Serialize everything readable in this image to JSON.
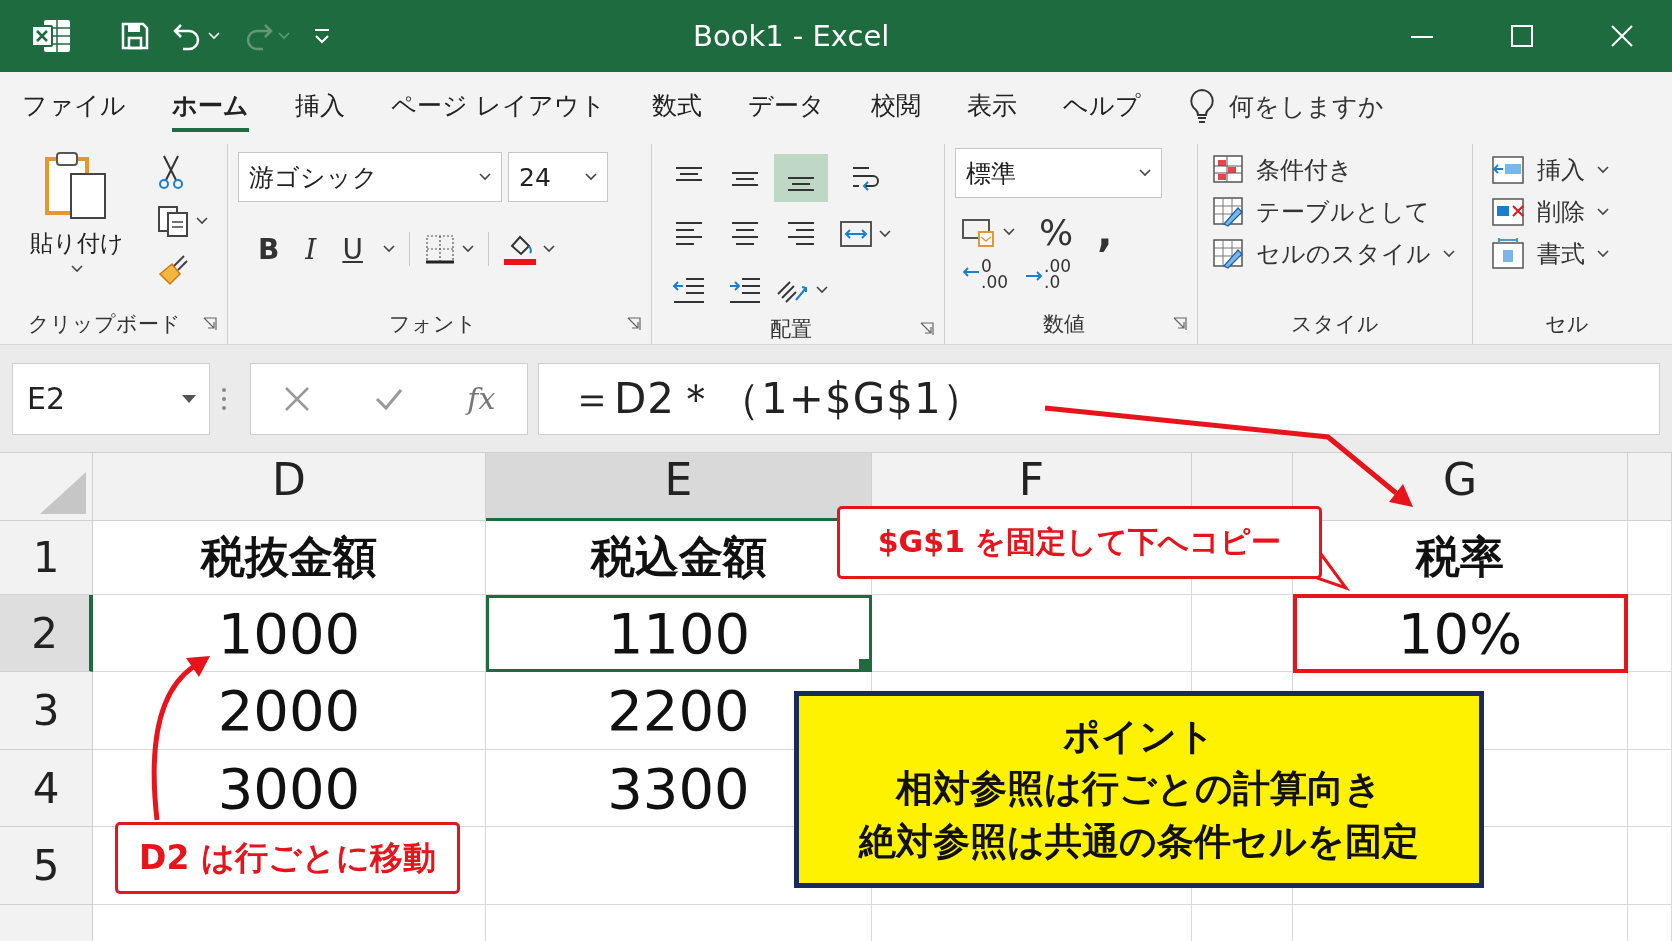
{
  "window": {
    "title": "Book1 - Excel"
  },
  "quick_access": [
    {
      "kind": "save"
    },
    {
      "kind": "undo",
      "disabled": false
    },
    {
      "kind": "redo",
      "disabled": true
    },
    {
      "kind": "customize"
    }
  ],
  "tabs": [
    {
      "label": "ファイル",
      "selected": false
    },
    {
      "label": "ホーム",
      "selected": true
    },
    {
      "label": "挿入",
      "selected": false
    },
    {
      "label": "ページ レイアウト",
      "selected": false
    },
    {
      "label": "数式",
      "selected": false
    },
    {
      "label": "データ",
      "selected": false
    },
    {
      "label": "校閲",
      "selected": false
    },
    {
      "label": "表示",
      "selected": false
    },
    {
      "label": "ヘルプ",
      "selected": false
    }
  ],
  "tell_me": {
    "placeholder": "何をしますか"
  },
  "ribbon": [
    {
      "kind": "clipboard",
      "label": "クリップボード",
      "paste": "貼り付け"
    },
    {
      "kind": "font",
      "label": "フォント",
      "font_name": "游ゴシック",
      "font_size": "24",
      "styles": [
        {
          "kind": "bold",
          "text": "B"
        },
        {
          "kind": "italic",
          "text": "I"
        },
        {
          "kind": "underline",
          "text": "U"
        }
      ]
    },
    {
      "kind": "alignment",
      "label": "配置",
      "vertical": [
        {
          "selected": false
        },
        {
          "selected": false
        },
        {
          "selected": true
        }
      ]
    },
    {
      "kind": "number",
      "label": "数値",
      "format": "標準",
      "percent": "%",
      "comma": ",",
      "decimals": [
        {
          "kind": "increase",
          "lines": [
            "0",
            ".00"
          ]
        },
        {
          "kind": "decrease",
          "lines": [
            ".00",
            ".0"
          ]
        }
      ]
    },
    {
      "kind": "styles",
      "label": "スタイル",
      "items": [
        {
          "kind": "conditional",
          "text": "条件付き"
        },
        {
          "kind": "table",
          "text": "テーブルとして"
        },
        {
          "kind": "cell",
          "text": "セルのスタイル"
        }
      ]
    },
    {
      "kind": "cells",
      "label": "セル",
      "items": [
        {
          "kind": "insert",
          "text": "挿入"
        },
        {
          "kind": "delete",
          "text": "削除"
        },
        {
          "kind": "format",
          "text": "書式"
        }
      ]
    }
  ],
  "formula_bar": {
    "name_box": "E2",
    "fx": "fx",
    "formula": "＝D2＊（1+$G$1）"
  },
  "sheet": {
    "columns": [
      {
        "header": "D",
        "selected": false
      },
      {
        "header": "E",
        "selected": true
      },
      {
        "header": "F",
        "selected": false
      },
      {
        "selected": false
      },
      {
        "header": "G",
        "selected": false
      },
      {
        "selected": false
      }
    ],
    "rows": [
      {
        "number": "1",
        "kind": "heading",
        "selected": false,
        "cells": [
          "税抜金額",
          "税込金額",
          "",
          "",
          "税率",
          ""
        ]
      },
      {
        "number": "2",
        "kind": "data",
        "selected": true,
        "cells": [
          "1000",
          "1100",
          "",
          "",
          "10%",
          ""
        ]
      },
      {
        "number": "3",
        "kind": "data",
        "selected": false,
        "cells": [
          "2000",
          "2200",
          "",
          "",
          "",
          ""
        ]
      },
      {
        "number": "4",
        "kind": "data",
        "selected": false,
        "cells": [
          "3000",
          "3300",
          "",
          "",
          "",
          ""
        ]
      },
      {
        "number": "5",
        "kind": "data",
        "selected": false,
        "cells": [
          "",
          "",
          "",
          "",
          "",
          ""
        ]
      }
    ]
  },
  "annotations": [
    {
      "kind": "callout",
      "text": "$G$1 を固定して下へコピー"
    },
    {
      "kind": "label",
      "text": "D2 は行ごとに移動"
    },
    {
      "kind": "note",
      "title": "ポイント",
      "lines": [
        "相対参照は行ごとの計算向き",
        "絶対参照は共通の条件セルを固定"
      ]
    }
  ]
}
